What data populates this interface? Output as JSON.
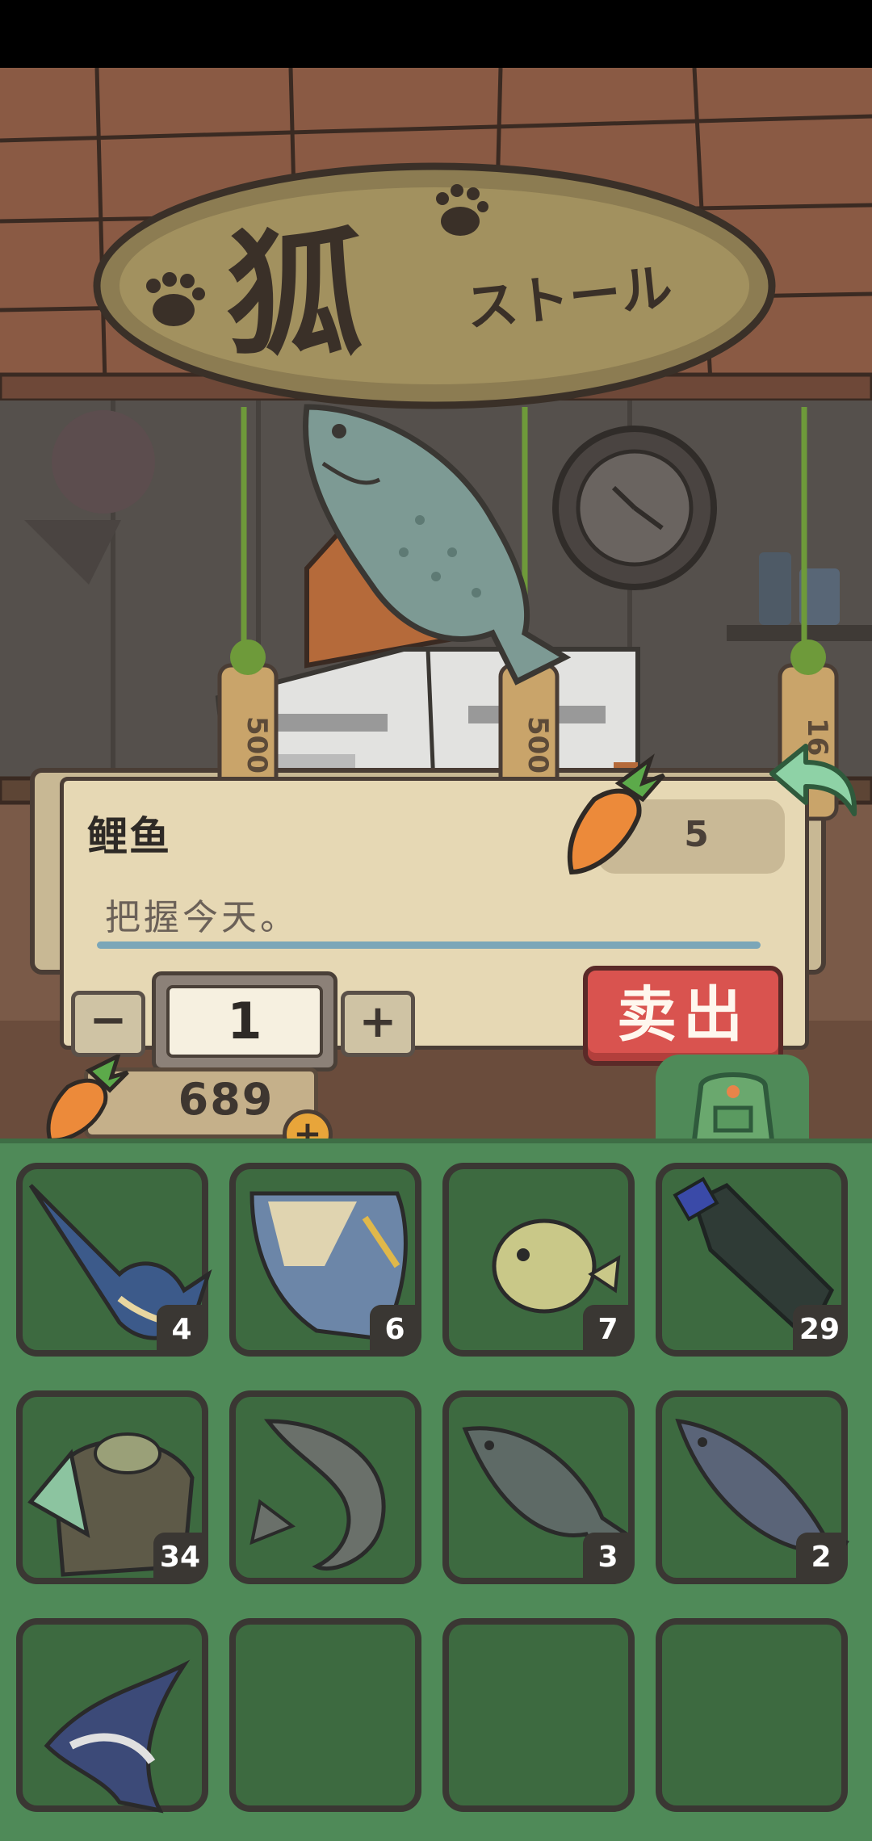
{
  "shop": {
    "sign_title": "狐",
    "sign_subtitle": "ストール",
    "price_tags": [
      "500",
      "500",
      "16"
    ]
  },
  "selected_item": {
    "name": "鲤鱼",
    "price": "5",
    "description": "把握今天。"
  },
  "quantity": {
    "minus_label": "−",
    "value": "1",
    "plus_label": "+"
  },
  "sell_button": {
    "label": "卖出"
  },
  "wallet": {
    "amount": "689",
    "add_label": "+"
  },
  "inventory": [
    {
      "item": "swordfish-icon",
      "count": "4"
    },
    {
      "item": "triggerfish-icon",
      "count": "6"
    },
    {
      "item": "pufferfish-icon",
      "count": "7"
    },
    {
      "item": "plastic-bottle-icon",
      "count": "29"
    },
    {
      "item": "old-bag-icon",
      "count": "34"
    },
    {
      "item": "sturgeon-icon",
      "count": ""
    },
    {
      "item": "carp-icon",
      "count": "3"
    },
    {
      "item": "salmon-icon",
      "count": "2"
    },
    {
      "item": "flying-fish-icon",
      "count": ""
    },
    {
      "item": "empty-slot",
      "count": ""
    },
    {
      "item": "empty-slot",
      "count": ""
    },
    {
      "item": "empty-slot",
      "count": ""
    }
  ],
  "colors": {
    "inventory_bg": "#4f8a58",
    "slot_bg": "#3d6a40",
    "sell_button": "#d9534f",
    "panel_bg": "#e6d8b4",
    "accent_line": "#7ba6b8"
  }
}
